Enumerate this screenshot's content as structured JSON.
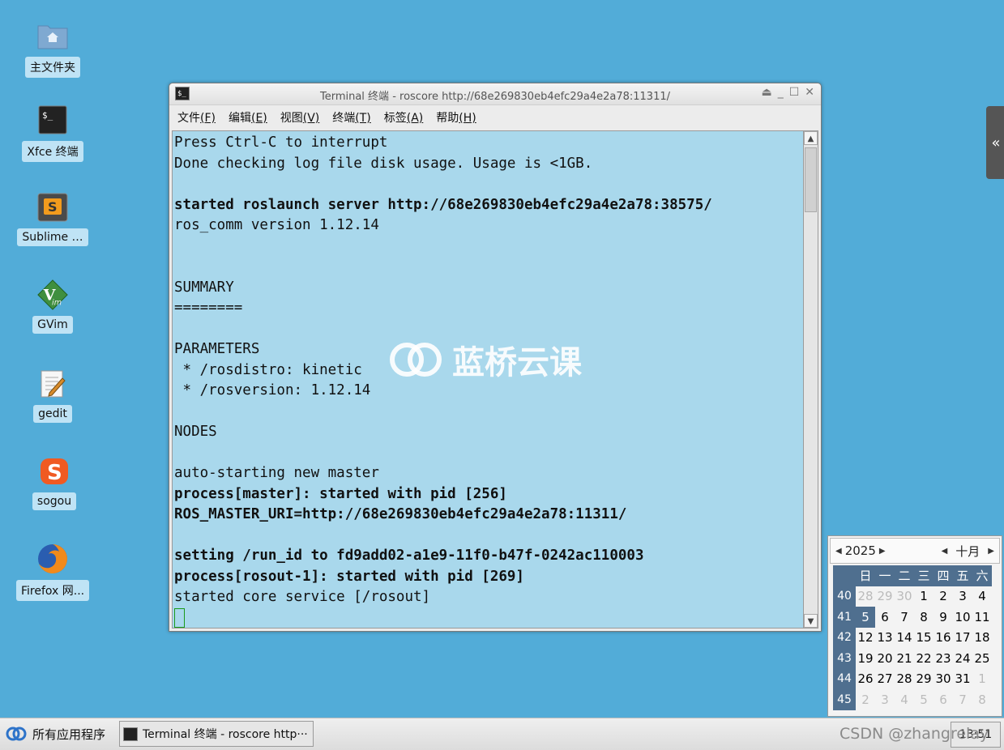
{
  "desktop": {
    "icons": [
      {
        "label": "主文件夹"
      },
      {
        "label": "Xfce 终端"
      },
      {
        "label": "Sublime …"
      },
      {
        "label": "GVim"
      },
      {
        "label": "gedit"
      },
      {
        "label": "sogou"
      },
      {
        "label": "Firefox 网..."
      }
    ]
  },
  "window": {
    "title": "Terminal 终端 - roscore http://68e269830eb4efc29a4e2a78:11311/",
    "menu": [
      {
        "label": "文件",
        "key": "(F)"
      },
      {
        "label": "编辑",
        "key": "(E)"
      },
      {
        "label": "视图",
        "key": "(V)"
      },
      {
        "label": "终端",
        "key": "(T)"
      },
      {
        "label": "标签",
        "key": "(A)"
      },
      {
        "label": "帮助",
        "key": "(H)"
      }
    ]
  },
  "terminal": {
    "lines": [
      {
        "text": "Press Ctrl-C to interrupt",
        "bold": false
      },
      {
        "text": "Done checking log file disk usage. Usage is <1GB.",
        "bold": false
      },
      {
        "text": "",
        "bold": false
      },
      {
        "text": "started roslaunch server http://68e269830eb4efc29a4e2a78:38575/",
        "bold": true
      },
      {
        "text": "ros_comm version 1.12.14",
        "bold": false
      },
      {
        "text": "",
        "bold": false
      },
      {
        "text": "",
        "bold": false
      },
      {
        "text": "SUMMARY",
        "bold": false
      },
      {
        "text": "========",
        "bold": false
      },
      {
        "text": "",
        "bold": false
      },
      {
        "text": "PARAMETERS",
        "bold": false
      },
      {
        "text": " * /rosdistro: kinetic",
        "bold": false
      },
      {
        "text": " * /rosversion: 1.12.14",
        "bold": false
      },
      {
        "text": "",
        "bold": false
      },
      {
        "text": "NODES",
        "bold": false
      },
      {
        "text": "",
        "bold": false
      },
      {
        "text": "auto-starting new master",
        "bold": false
      },
      {
        "text": "process[master]: started with pid [256]",
        "bold": true
      },
      {
        "text": "ROS_MASTER_URI=http://68e269830eb4efc29a4e2a78:11311/",
        "bold": true
      },
      {
        "text": "",
        "bold": false
      },
      {
        "text": "setting /run_id to fd9add02-a1e9-11f0-b47f-0242ac110003",
        "bold": true
      },
      {
        "text": "process[rosout-1]: started with pid [269]",
        "bold": true
      },
      {
        "text": "started core service [/rosout]",
        "bold": false
      }
    ]
  },
  "watermark": {
    "text": "蓝桥云课"
  },
  "sidetab": {
    "label": "«"
  },
  "calendar": {
    "year": "2025",
    "month": "十月",
    "weekday_headers": [
      "日",
      "一",
      "二",
      "三",
      "四",
      "五",
      "六"
    ],
    "weeks": [
      {
        "num": "40",
        "days": [
          {
            "d": "28",
            "o": true
          },
          {
            "d": "29",
            "o": true
          },
          {
            "d": "30",
            "o": true
          },
          {
            "d": "1",
            "o": false
          },
          {
            "d": "2",
            "o": false
          },
          {
            "d": "3",
            "o": false
          },
          {
            "d": "4",
            "o": false
          }
        ]
      },
      {
        "num": "41",
        "days": [
          {
            "d": "5",
            "o": false,
            "today": true
          },
          {
            "d": "6",
            "o": false
          },
          {
            "d": "7",
            "o": false
          },
          {
            "d": "8",
            "o": false
          },
          {
            "d": "9",
            "o": false
          },
          {
            "d": "10",
            "o": false
          },
          {
            "d": "11",
            "o": false
          }
        ]
      },
      {
        "num": "42",
        "days": [
          {
            "d": "12",
            "o": false
          },
          {
            "d": "13",
            "o": false
          },
          {
            "d": "14",
            "o": false
          },
          {
            "d": "15",
            "o": false
          },
          {
            "d": "16",
            "o": false
          },
          {
            "d": "17",
            "o": false
          },
          {
            "d": "18",
            "o": false
          }
        ]
      },
      {
        "num": "43",
        "days": [
          {
            "d": "19",
            "o": false
          },
          {
            "d": "20",
            "o": false
          },
          {
            "d": "21",
            "o": false
          },
          {
            "d": "22",
            "o": false
          },
          {
            "d": "23",
            "o": false
          },
          {
            "d": "24",
            "o": false
          },
          {
            "d": "25",
            "o": false
          }
        ]
      },
      {
        "num": "44",
        "days": [
          {
            "d": "26",
            "o": false
          },
          {
            "d": "27",
            "o": false
          },
          {
            "d": "28",
            "o": false
          },
          {
            "d": "29",
            "o": false
          },
          {
            "d": "30",
            "o": false
          },
          {
            "d": "31",
            "o": false
          },
          {
            "d": "1",
            "o": true
          }
        ]
      },
      {
        "num": "45",
        "days": [
          {
            "d": "2",
            "o": true
          },
          {
            "d": "3",
            "o": true
          },
          {
            "d": "4",
            "o": true
          },
          {
            "d": "5",
            "o": true
          },
          {
            "d": "6",
            "o": true
          },
          {
            "d": "7",
            "o": true
          },
          {
            "d": "8",
            "o": true
          }
        ]
      }
    ]
  },
  "taskbar": {
    "apps_label": "所有应用程序",
    "task_label": "Terminal 终端 - roscore http···",
    "clock": "13:51",
    "watermark": "CSDN @zhangrelay"
  },
  "colors": {
    "desktop": "#52acd8",
    "terminal_bg": "#a9d8ec",
    "calendar_accent": "#4f6f8f"
  }
}
